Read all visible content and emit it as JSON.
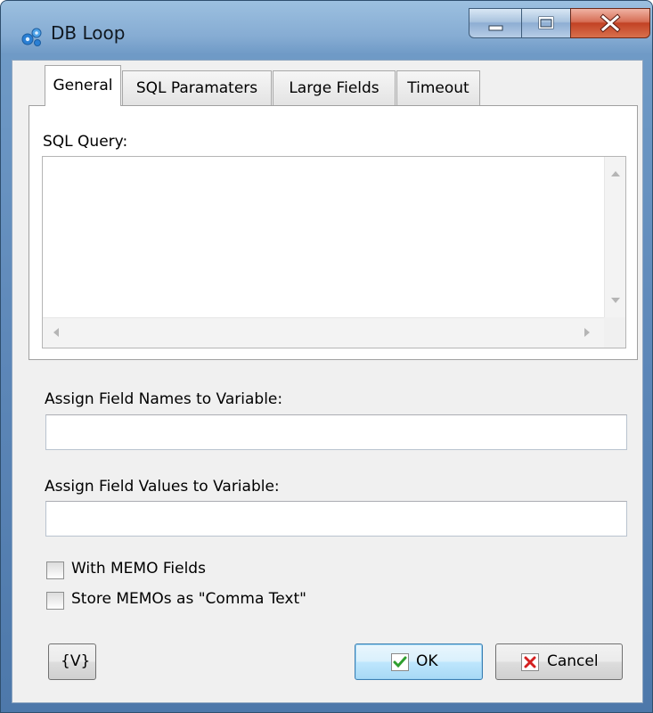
{
  "window": {
    "title": "DB Loop",
    "caption_buttons": {
      "minimize": "minimize",
      "maximize": "maximize",
      "close": "close"
    }
  },
  "tabs": [
    {
      "label": "General",
      "active": true
    },
    {
      "label": "SQL Paramaters",
      "active": false
    },
    {
      "label": "Large Fields",
      "active": false
    },
    {
      "label": "Timeout",
      "active": false
    }
  ],
  "general": {
    "sql_query_label": "SQL Query:",
    "sql_query_value": ""
  },
  "fields": {
    "names_label": "Assign Field Names to Variable:",
    "names_value": "",
    "values_label": "Assign Field Values to Variable:",
    "values_value": ""
  },
  "checkboxes": [
    {
      "label": "With MEMO Fields",
      "checked": false
    },
    {
      "label": "Store MEMOs as \"Comma Text\"",
      "checked": false
    }
  ],
  "buttons": {
    "variables": "{V}",
    "ok": "OK",
    "cancel": "Cancel"
  },
  "colors": {
    "frame": "#6f9ac6",
    "client": "#f0f0f0",
    "ok_check": "#2e9e2e",
    "cancel_x": "#d42020",
    "close_button": "#c24224"
  },
  "icons": {
    "app": "gears-icon",
    "ok": "check-icon",
    "cancel": "x-icon"
  }
}
